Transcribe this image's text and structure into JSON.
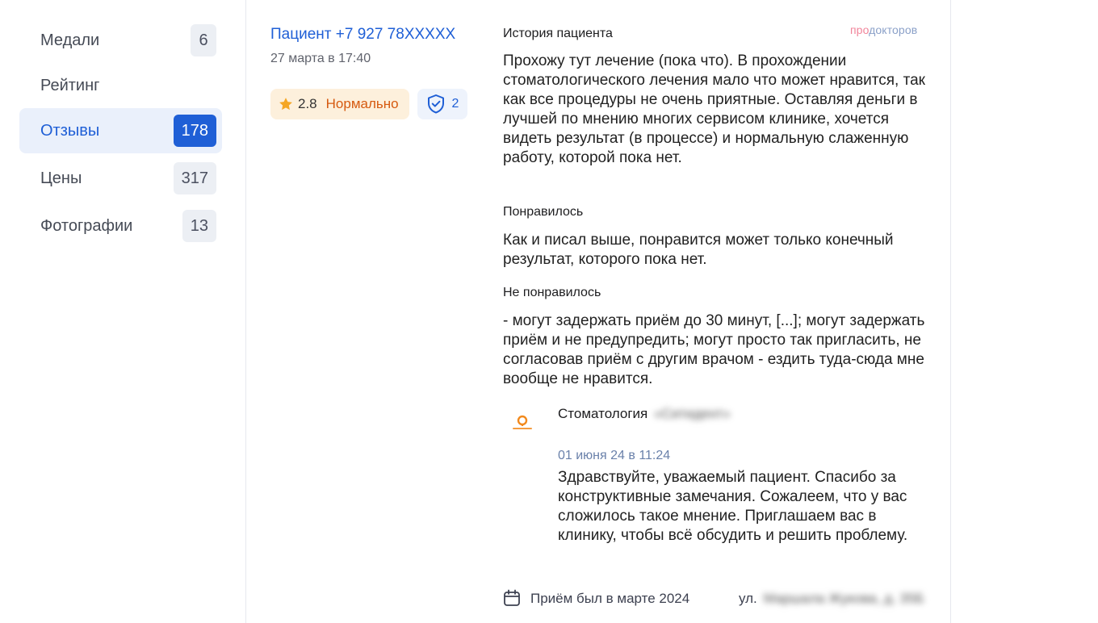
{
  "sidebar": {
    "items": [
      {
        "label": "Медали",
        "count": "6"
      },
      {
        "label": "Рейтинг",
        "count": ""
      },
      {
        "label": "Отзывы",
        "count": "178"
      },
      {
        "label": "Цены",
        "count": "317"
      },
      {
        "label": "Фотографии",
        "count": "13"
      }
    ]
  },
  "review": {
    "author": "Пациент +7 927 78XXXXX",
    "date": "27 марта в 17:40",
    "rating_value": "2.8",
    "rating_text": "Нормально",
    "verified_count": "2",
    "brand_pro": "про",
    "brand_rest": "докторов",
    "history_title": "История пациента",
    "history_text": "Прохожу тут лечение (пока что). В прохождении стоматологического лечения мало что может нравится, так как все процедуры не очень приятные. Оставляя деньги в лучшей по мнению многих сервисом клинике, хочется видеть результат (в процессе) и нормальную слаженную работу, которой пока нет.",
    "liked_title": "Понравилось",
    "liked_text": "Как и писал выше, понравится может только конечный результат, которого пока нет.",
    "disliked_title": "Не понравилось",
    "disliked_text": "- могут задержать приём до 30 минут, [...]; могут задержать приём и не предупредить; могут просто так пригласить, не согласовав приём с другим врачом - ездить туда-сюда мне вообще не нравится.",
    "visit_text": "Приём был в марте 2024",
    "address_prefix": "ул.",
    "address_blurred": "Маршала Жукова, д. 35Б"
  },
  "reply": {
    "clinic_label": "Стоматология",
    "clinic_name_blurred": "«Ситидент»",
    "date": "01 июня 24 в 11:24",
    "text": "Здравствуйте, уважаемый пациент. Спасибо за конструктивные замечания. Сожалеем, что у вас сложилось такое мнение. Приглашаем вас в клинику, чтобы всё обсудить и решить проблему."
  },
  "colors": {
    "accent": "#1f5fd6",
    "rating_bg": "#fdf0dc",
    "rating_text": "#d65a10",
    "star": "#f5a623"
  },
  "icons": {
    "star": "star-icon",
    "verified": "shield-check-icon",
    "calendar": "calendar-icon",
    "clinic_logo": "clinic-logo"
  }
}
